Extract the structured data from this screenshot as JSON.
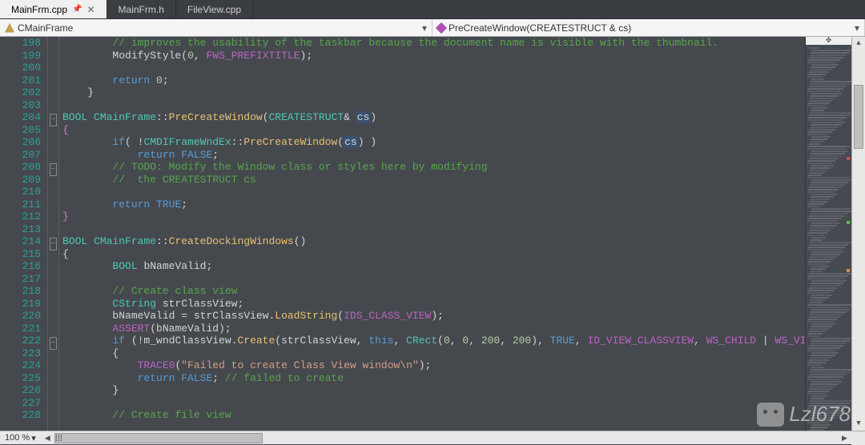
{
  "tabs": [
    {
      "label": "MainFrm.cpp",
      "active": true,
      "pinned": true
    },
    {
      "label": "MainFrm.h",
      "active": false
    },
    {
      "label": "FileView.cpp",
      "active": false
    }
  ],
  "nav": {
    "class": "CMainFrame",
    "member": "PreCreateWindow(CREATESTRUCT & cs)"
  },
  "zoom": "100 %",
  "watermark": "Lzl678",
  "lines_start": 198,
  "lines_end": 228,
  "code": {
    "198": {
      "indent": 2,
      "tokens": [
        {
          "t": "// improves the usability of the taskbar because the document name is visible with the thumbnail.",
          "c": "c-comment"
        }
      ]
    },
    "199": {
      "indent": 2,
      "tokens": [
        {
          "t": "ModifyStyle",
          "c": ""
        },
        {
          "t": "(",
          "c": ""
        },
        {
          "t": "0",
          "c": "c-num"
        },
        {
          "t": ", ",
          "c": ""
        },
        {
          "t": "FWS_PREFIXTITLE",
          "c": "c-macro"
        },
        {
          "t": ");",
          "c": ""
        }
      ]
    },
    "200": {
      "indent": 0,
      "tokens": []
    },
    "201": {
      "indent": 2,
      "tokens": [
        {
          "t": "return",
          "c": "c-keyword"
        },
        {
          "t": " ",
          "c": ""
        },
        {
          "t": "0",
          "c": "c-num"
        },
        {
          "t": ";",
          "c": ""
        }
      ]
    },
    "202": {
      "indent": 1,
      "tokens": [
        {
          "t": "}",
          "c": ""
        }
      ]
    },
    "203": {
      "indent": 0,
      "tokens": []
    },
    "204": {
      "indent": 0,
      "fold": "-",
      "tokens": [
        {
          "t": "BOOL",
          "c": "c-type"
        },
        {
          "t": " ",
          "c": ""
        },
        {
          "t": "CMainFrame",
          "c": "c-type"
        },
        {
          "t": "::",
          "c": ""
        },
        {
          "t": "PreCreateWindow",
          "c": "c-func"
        },
        {
          "t": "(",
          "c": ""
        },
        {
          "t": "CREATESTRUCT",
          "c": "c-type"
        },
        {
          "t": "& ",
          "c": ""
        },
        {
          "t": "cs",
          "c": "c-hl"
        },
        {
          "t": ")",
          "c": ""
        }
      ]
    },
    "205": {
      "indent": 0,
      "tokens": [
        {
          "t": "{",
          "c": "c-brace"
        }
      ]
    },
    "206": {
      "indent": 2,
      "tokens": [
        {
          "t": "if",
          "c": "c-keyword"
        },
        {
          "t": "( !",
          "c": ""
        },
        {
          "t": "CMDIFrameWndEx",
          "c": "c-type"
        },
        {
          "t": "::",
          "c": ""
        },
        {
          "t": "PreCreateWindow",
          "c": "c-func"
        },
        {
          "t": "(",
          "c": ""
        },
        {
          "t": "cs",
          "c": "c-hl"
        },
        {
          "t": ") )",
          "c": ""
        }
      ]
    },
    "207": {
      "indent": 3,
      "tokens": [
        {
          "t": "return",
          "c": "c-keyword"
        },
        {
          "t": " ",
          "c": ""
        },
        {
          "t": "FALSE",
          "c": "c-keyword"
        },
        {
          "t": ";",
          "c": ""
        }
      ]
    },
    "208": {
      "indent": 2,
      "fold": "-",
      "tokens": [
        {
          "t": "// TODO: Modify the Window class or styles here by modifying",
          "c": "c-comment"
        }
      ]
    },
    "209": {
      "indent": 2,
      "tokens": [
        {
          "t": "//  the CREATESTRUCT cs",
          "c": "c-comment"
        }
      ]
    },
    "210": {
      "indent": 0,
      "tokens": []
    },
    "211": {
      "indent": 2,
      "tokens": [
        {
          "t": "return",
          "c": "c-keyword"
        },
        {
          "t": " ",
          "c": ""
        },
        {
          "t": "TRUE",
          "c": "c-keyword"
        },
        {
          "t": ";",
          "c": ""
        }
      ]
    },
    "212": {
      "indent": 0,
      "tokens": [
        {
          "t": "}",
          "c": "c-brace"
        }
      ]
    },
    "213": {
      "indent": 0,
      "tokens": []
    },
    "214": {
      "indent": 0,
      "fold": "-",
      "tokens": [
        {
          "t": "BOOL",
          "c": "c-type"
        },
        {
          "t": " ",
          "c": ""
        },
        {
          "t": "CMainFrame",
          "c": "c-type"
        },
        {
          "t": "::",
          "c": ""
        },
        {
          "t": "CreateDockingWindows",
          "c": "c-func"
        },
        {
          "t": "()",
          "c": ""
        }
      ]
    },
    "215": {
      "indent": 0,
      "tokens": [
        {
          "t": "{",
          "c": ""
        }
      ]
    },
    "216": {
      "indent": 2,
      "tokens": [
        {
          "t": "BOOL",
          "c": "c-type"
        },
        {
          "t": " bNameValid;",
          "c": ""
        }
      ]
    },
    "217": {
      "indent": 0,
      "tokens": []
    },
    "218": {
      "indent": 2,
      "tokens": [
        {
          "t": "// Create class view",
          "c": "c-comment"
        }
      ]
    },
    "219": {
      "indent": 2,
      "tokens": [
        {
          "t": "CString",
          "c": "c-type"
        },
        {
          "t": " strClassView;",
          "c": ""
        }
      ]
    },
    "220": {
      "indent": 2,
      "tokens": [
        {
          "t": "bNameValid = strClassView.",
          "c": ""
        },
        {
          "t": "LoadString",
          "c": "c-func"
        },
        {
          "t": "(",
          "c": ""
        },
        {
          "t": "IDS_CLASS_VIEW",
          "c": "c-macro"
        },
        {
          "t": ");",
          "c": ""
        }
      ]
    },
    "221": {
      "indent": 2,
      "tokens": [
        {
          "t": "ASSERT",
          "c": "c-macro"
        },
        {
          "t": "(bNameValid);",
          "c": ""
        }
      ]
    },
    "222": {
      "indent": 2,
      "fold": "-",
      "tokens": [
        {
          "t": "if",
          "c": "c-keyword"
        },
        {
          "t": " (!m_wndClassView.",
          "c": ""
        },
        {
          "t": "Create",
          "c": "c-func"
        },
        {
          "t": "(strClassView, ",
          "c": ""
        },
        {
          "t": "this",
          "c": "c-keyword"
        },
        {
          "t": ", ",
          "c": ""
        },
        {
          "t": "CRect",
          "c": "c-type"
        },
        {
          "t": "(",
          "c": ""
        },
        {
          "t": "0",
          "c": "c-num"
        },
        {
          "t": ", ",
          "c": ""
        },
        {
          "t": "0",
          "c": "c-num"
        },
        {
          "t": ", ",
          "c": ""
        },
        {
          "t": "200",
          "c": "c-num"
        },
        {
          "t": ", ",
          "c": ""
        },
        {
          "t": "200",
          "c": "c-num"
        },
        {
          "t": "), ",
          "c": ""
        },
        {
          "t": "TRUE",
          "c": "c-keyword"
        },
        {
          "t": ", ",
          "c": ""
        },
        {
          "t": "ID_VIEW_CLASSVIEW",
          "c": "c-macro"
        },
        {
          "t": ", ",
          "c": ""
        },
        {
          "t": "WS_CHILD",
          "c": "c-macro"
        },
        {
          "t": " | ",
          "c": ""
        },
        {
          "t": "WS_VISIBL",
          "c": "c-macro"
        }
      ]
    },
    "223": {
      "indent": 2,
      "tokens": [
        {
          "t": "{",
          "c": ""
        }
      ]
    },
    "224": {
      "indent": 3,
      "tokens": [
        {
          "t": "TRACE0",
          "c": "c-macro"
        },
        {
          "t": "(",
          "c": ""
        },
        {
          "t": "\"Failed to create Class View window\\n\"",
          "c": "c-string"
        },
        {
          "t": ");",
          "c": ""
        }
      ]
    },
    "225": {
      "indent": 3,
      "tokens": [
        {
          "t": "return",
          "c": "c-keyword"
        },
        {
          "t": " ",
          "c": ""
        },
        {
          "t": "FALSE",
          "c": "c-keyword"
        },
        {
          "t": "; ",
          "c": ""
        },
        {
          "t": "// failed to create",
          "c": "c-comment"
        }
      ]
    },
    "226": {
      "indent": 2,
      "tokens": [
        {
          "t": "}",
          "c": ""
        }
      ]
    },
    "227": {
      "indent": 0,
      "tokens": []
    },
    "228": {
      "indent": 2,
      "tokens": [
        {
          "t": "// Create file view",
          "c": "c-comment"
        }
      ]
    }
  }
}
